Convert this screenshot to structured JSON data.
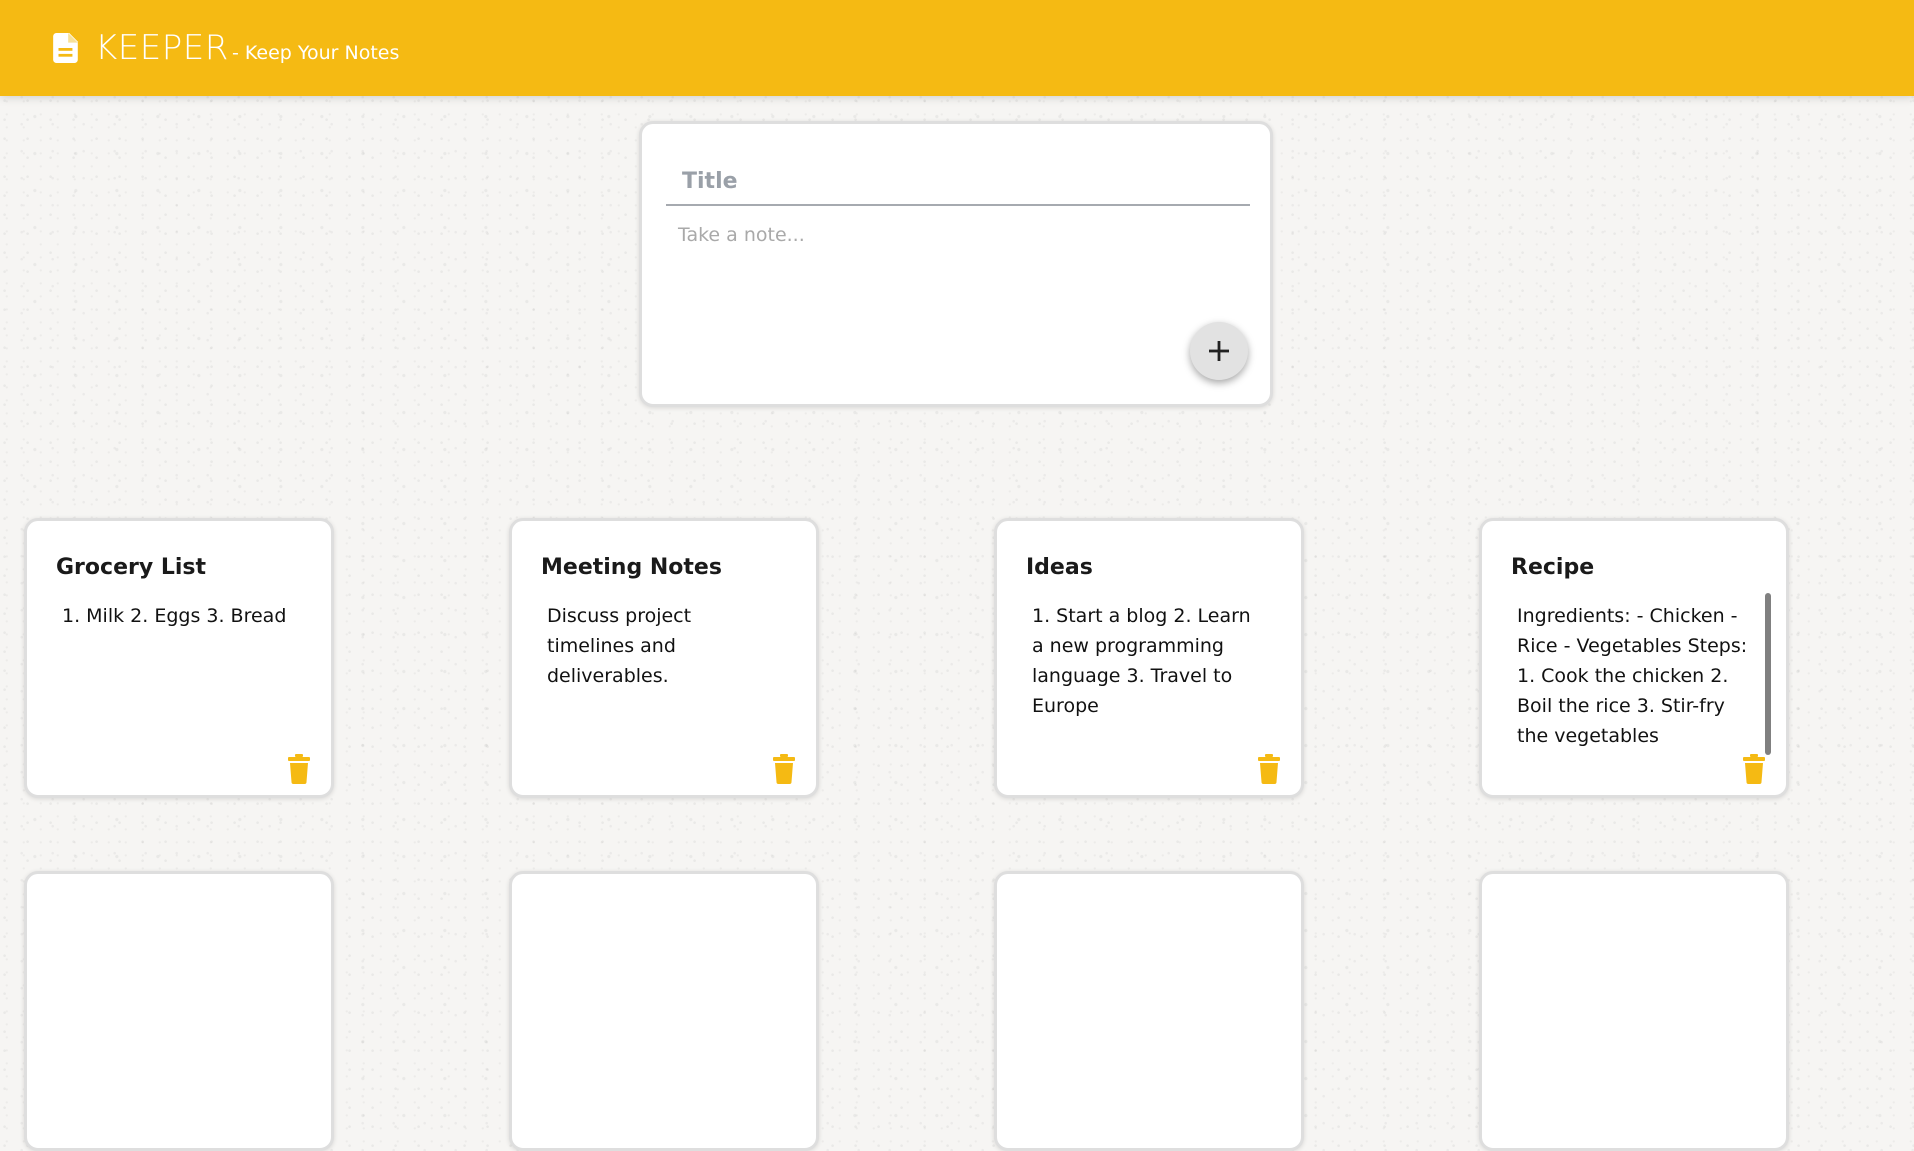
{
  "colors": {
    "accent": "#f5ba13",
    "header_text": "#ffffff",
    "card_border": "#dedede",
    "add_button_bg": "#e2e2e2"
  },
  "header": {
    "icon": "note-icon",
    "title": "KEEPER",
    "subtitle": "- Keep Your Notes"
  },
  "create_area": {
    "title_placeholder": "Title",
    "title_value": "",
    "note_placeholder": "Take a note...",
    "note_value": "",
    "add_button_icon": "plus-icon"
  },
  "notes": [
    {
      "title": "Grocery List",
      "content": "1. Milk 2. Eggs 3. Bread",
      "delete_icon": "trash-icon"
    },
    {
      "title": "Meeting Notes",
      "content": "Discuss project timelines and deliverables.",
      "delete_icon": "trash-icon"
    },
    {
      "title": "Ideas",
      "content": "1. Start a blog 2. Learn a new programming language 3. Travel to Europe",
      "delete_icon": "trash-icon"
    },
    {
      "title": "Recipe",
      "content": "Ingredients: - Chicken - Rice - Vegetables Steps: 1. Cook the chicken 2. Boil the rice 3. Stir-fry the vegetables",
      "delete_icon": "trash-icon"
    }
  ]
}
